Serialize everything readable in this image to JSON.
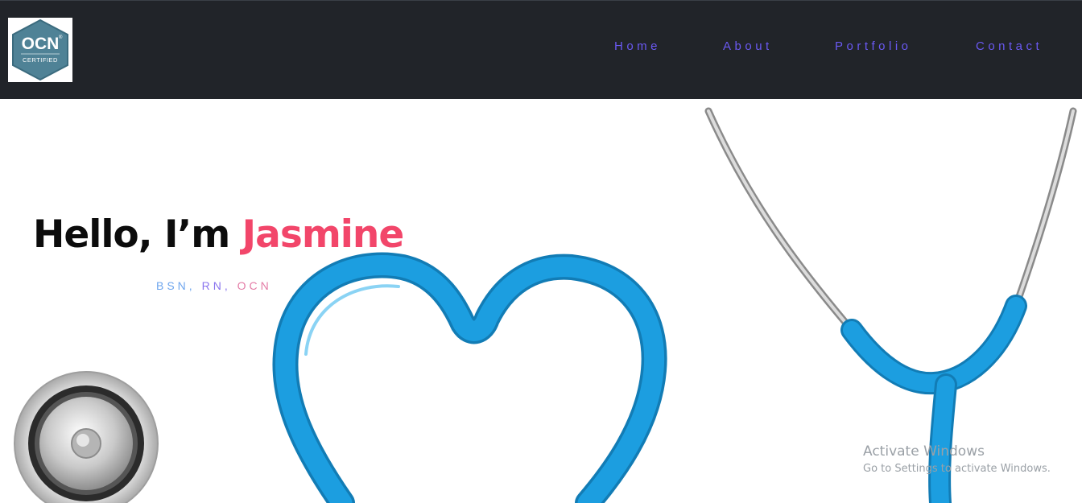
{
  "nav": {
    "logo": {
      "main": "OCN",
      "registered": "®",
      "sub": "CERTIFIED",
      "color": "#4f8296"
    },
    "links": [
      {
        "label": "Home",
        "icon": ""
      },
      {
        "label": "About"
      },
      {
        "label": "Portfolio"
      },
      {
        "label": "Contact"
      }
    ],
    "link_color": "#6a59f2",
    "background": "#212429"
  },
  "hero": {
    "greeting": "Hello, I’m",
    "name": "Jasmine",
    "name_color": "#f2466a",
    "credentials": [
      "BSN",
      "RN",
      "OCN"
    ],
    "credential_separator": ", ",
    "art": {
      "tube_color": "#1c9ee0",
      "metal_color": "#b8b8b8",
      "icons": [
        "stethoscope-heart-icon",
        "stethoscope-chestpiece-icon"
      ]
    }
  },
  "watermark": {
    "title": "Activate Windows",
    "subtitle": "Go to Settings to activate Windows."
  }
}
